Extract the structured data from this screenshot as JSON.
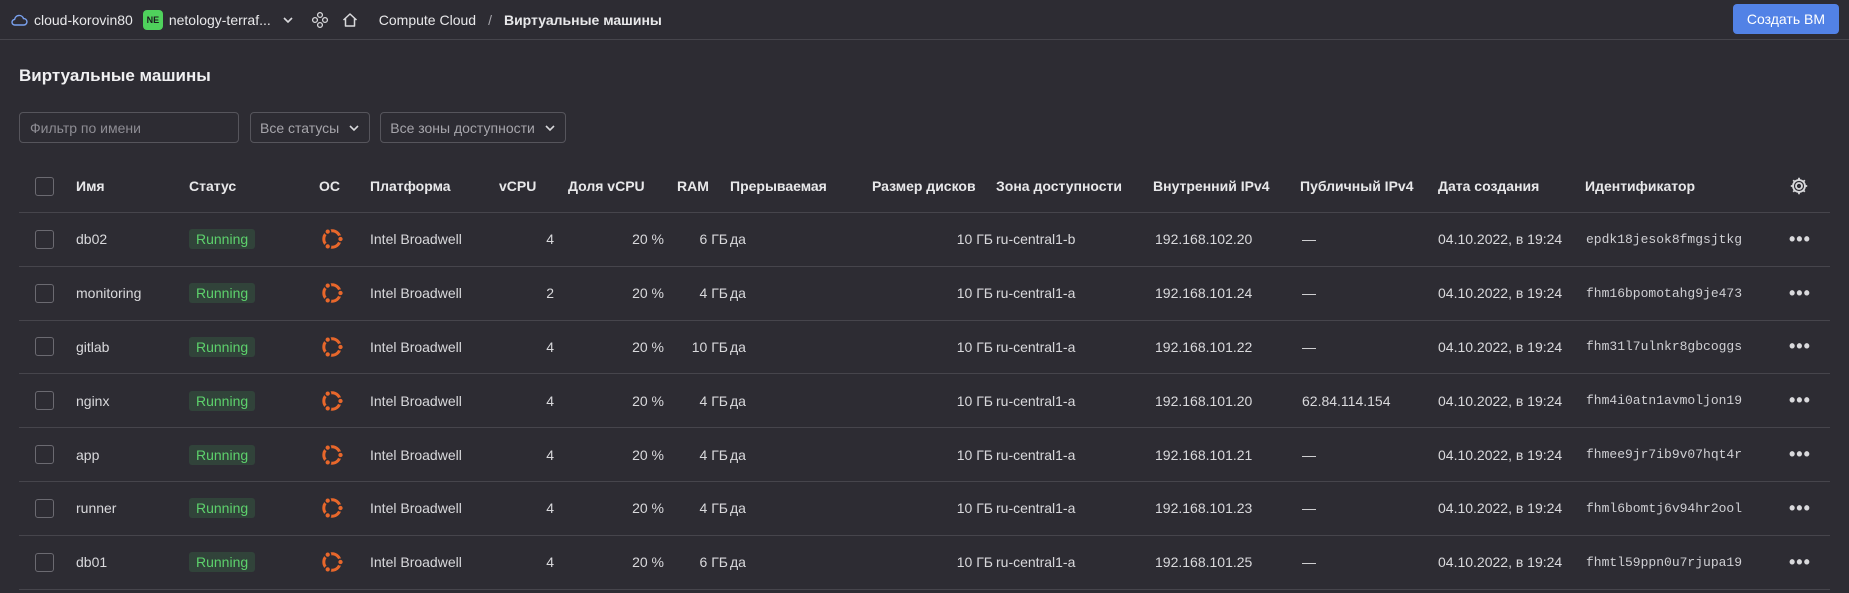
{
  "topbar": {
    "cloud_name": "cloud-korovin80",
    "folder_badge": "NE",
    "folder_name": "netology-terraf...",
    "breadcrumb_service": "Compute Cloud",
    "breadcrumb_sep": "/",
    "breadcrumb_current": "Виртуальные машины",
    "create_button": "Создать ВМ"
  },
  "colors": {
    "background": "#2d2c33",
    "accent": "#5282e6",
    "status_running": "#5dd16c",
    "folder_badge": "#4fd15c",
    "os_icon": "#e8672b"
  },
  "page": {
    "title": "Виртуальные машины"
  },
  "filters": {
    "name_placeholder": "Фильтр по имени",
    "status_select": "Все статусы",
    "zone_select": "Все зоны доступности"
  },
  "table": {
    "columns": {
      "name": "Имя",
      "status": "Статус",
      "os": "ОС",
      "platform": "Платформа",
      "vcpu": "vCPU",
      "core_fraction": "Доля vCPU",
      "ram": "RAM",
      "preemptible": "Прерываемая",
      "disk_size": "Размер дисков",
      "zone": "Зона доступности",
      "internal_ip": "Внутренний IPv4",
      "public_ip": "Публичный IPv4",
      "created": "Дата создания",
      "id": "Идентификатор"
    },
    "rows": [
      {
        "name": "db02",
        "status": "Running",
        "platform": "Intel Broadwell",
        "vcpu": "4",
        "core_fraction": "20 %",
        "ram": "6 ГБ",
        "preemptible": "да",
        "disk_size": "10 ГБ",
        "zone": "ru-central1-b",
        "internal_ip": "192.168.102.20",
        "public_ip": "—",
        "created": "04.10.2022, в 19:24",
        "id": "epdk18jesok8fmgsjtkg"
      },
      {
        "name": "monitoring",
        "status": "Running",
        "platform": "Intel Broadwell",
        "vcpu": "2",
        "core_fraction": "20 %",
        "ram": "4 ГБ",
        "preemptible": "да",
        "disk_size": "10 ГБ",
        "zone": "ru-central1-a",
        "internal_ip": "192.168.101.24",
        "public_ip": "—",
        "created": "04.10.2022, в 19:24",
        "id": "fhm16bpomotahg9je473"
      },
      {
        "name": "gitlab",
        "status": "Running",
        "platform": "Intel Broadwell",
        "vcpu": "4",
        "core_fraction": "20 %",
        "ram": "10 ГБ",
        "preemptible": "да",
        "disk_size": "10 ГБ",
        "zone": "ru-central1-a",
        "internal_ip": "192.168.101.22",
        "public_ip": "—",
        "created": "04.10.2022, в 19:24",
        "id": "fhm31l7ulnkr8gbcoggs"
      },
      {
        "name": "nginx",
        "status": "Running",
        "platform": "Intel Broadwell",
        "vcpu": "4",
        "core_fraction": "20 %",
        "ram": "4 ГБ",
        "preemptible": "да",
        "disk_size": "10 ГБ",
        "zone": "ru-central1-a",
        "internal_ip": "192.168.101.20",
        "public_ip": "62.84.114.154",
        "created": "04.10.2022, в 19:24",
        "id": "fhm4i0atn1avmoljon19"
      },
      {
        "name": "app",
        "status": "Running",
        "platform": "Intel Broadwell",
        "vcpu": "4",
        "core_fraction": "20 %",
        "ram": "4 ГБ",
        "preemptible": "да",
        "disk_size": "10 ГБ",
        "zone": "ru-central1-a",
        "internal_ip": "192.168.101.21",
        "public_ip": "—",
        "created": "04.10.2022, в 19:24",
        "id": "fhmee9jr7ib9v07hqt4r"
      },
      {
        "name": "runner",
        "status": "Running",
        "platform": "Intel Broadwell",
        "vcpu": "4",
        "core_fraction": "20 %",
        "ram": "4 ГБ",
        "preemptible": "да",
        "disk_size": "10 ГБ",
        "zone": "ru-central1-a",
        "internal_ip": "192.168.101.23",
        "public_ip": "—",
        "created": "04.10.2022, в 19:24",
        "id": "fhml6bomtj6v94hr2ool"
      },
      {
        "name": "db01",
        "status": "Running",
        "platform": "Intel Broadwell",
        "vcpu": "4",
        "core_fraction": "20 %",
        "ram": "6 ГБ",
        "preemptible": "да",
        "disk_size": "10 ГБ",
        "zone": "ru-central1-a",
        "internal_ip": "192.168.101.25",
        "public_ip": "—",
        "created": "04.10.2022, в 19:24",
        "id": "fhmtl59ppn0u7rjupa19"
      }
    ]
  }
}
